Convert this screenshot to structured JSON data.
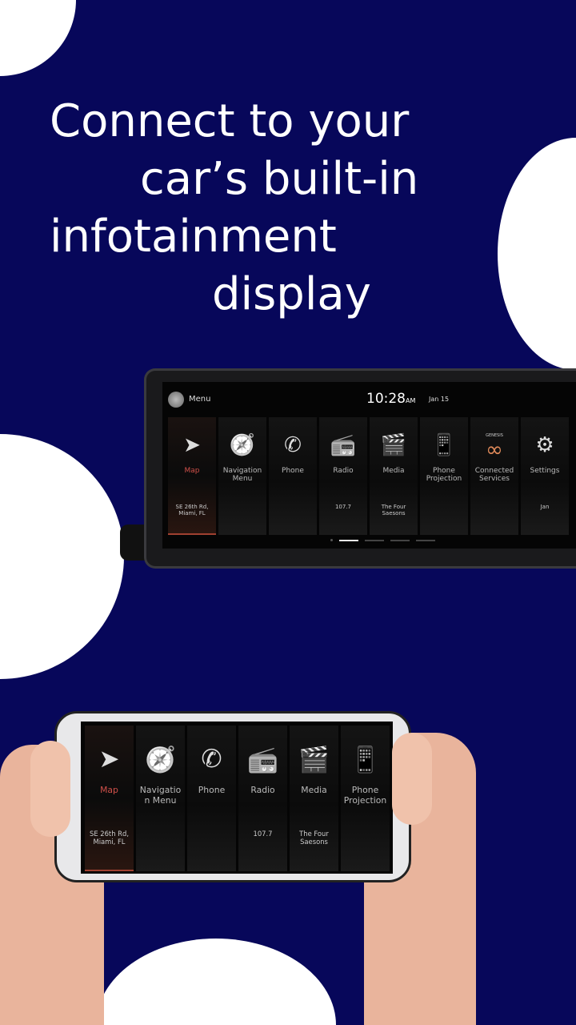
{
  "headline": {
    "line1": "Connect to your",
    "line2": "car’s built-in",
    "line3": "infotainment",
    "line4": "display"
  },
  "colors": {
    "background": "#07075a",
    "accent": "#d0504a",
    "connected_icon": "#e08a5a"
  },
  "car_display": {
    "menu_label": "Menu",
    "time": "10:28",
    "ampm": "AM",
    "date": "Jan 15",
    "tiles": [
      {
        "icon": "map-arrow-icon",
        "label": "Map",
        "sub": "SE 26th Rd, Miami, FL",
        "active": true
      },
      {
        "icon": "compass-icon",
        "label": "Navigation Menu",
        "sub": ""
      },
      {
        "icon": "phone-icon",
        "label": "Phone",
        "sub": ""
      },
      {
        "icon": "radio-icon",
        "label": "Radio",
        "sub": "107.7"
      },
      {
        "icon": "media-clapper-icon",
        "label": "Media",
        "sub": "The Four Saesons"
      },
      {
        "icon": "phone-projection-icon",
        "label": "Phone Projection",
        "sub": ""
      },
      {
        "icon": "genesis-connected-icon",
        "label": "Connected Services",
        "sub": "",
        "brand": "GENESIS"
      },
      {
        "icon": "settings-gear-icon",
        "label": "Settings",
        "sub": "Jan"
      }
    ],
    "page_count": 4,
    "current_page": 1
  },
  "phone_display": {
    "tiles": [
      {
        "icon": "map-arrow-icon",
        "label": "Map",
        "sub": "SE 26th Rd, Miami, FL",
        "active": true
      },
      {
        "icon": "compass-icon",
        "label": "Navigation Menu",
        "sub": ""
      },
      {
        "icon": "phone-icon",
        "label": "Phone",
        "sub": ""
      },
      {
        "icon": "radio-icon",
        "label": "Radio",
        "sub": "107.7"
      },
      {
        "icon": "media-clapper-icon",
        "label": "Media",
        "sub": "The Four Saesons"
      },
      {
        "icon": "phone-projection-icon",
        "label": "Phone Projection",
        "sub": ""
      }
    ]
  }
}
